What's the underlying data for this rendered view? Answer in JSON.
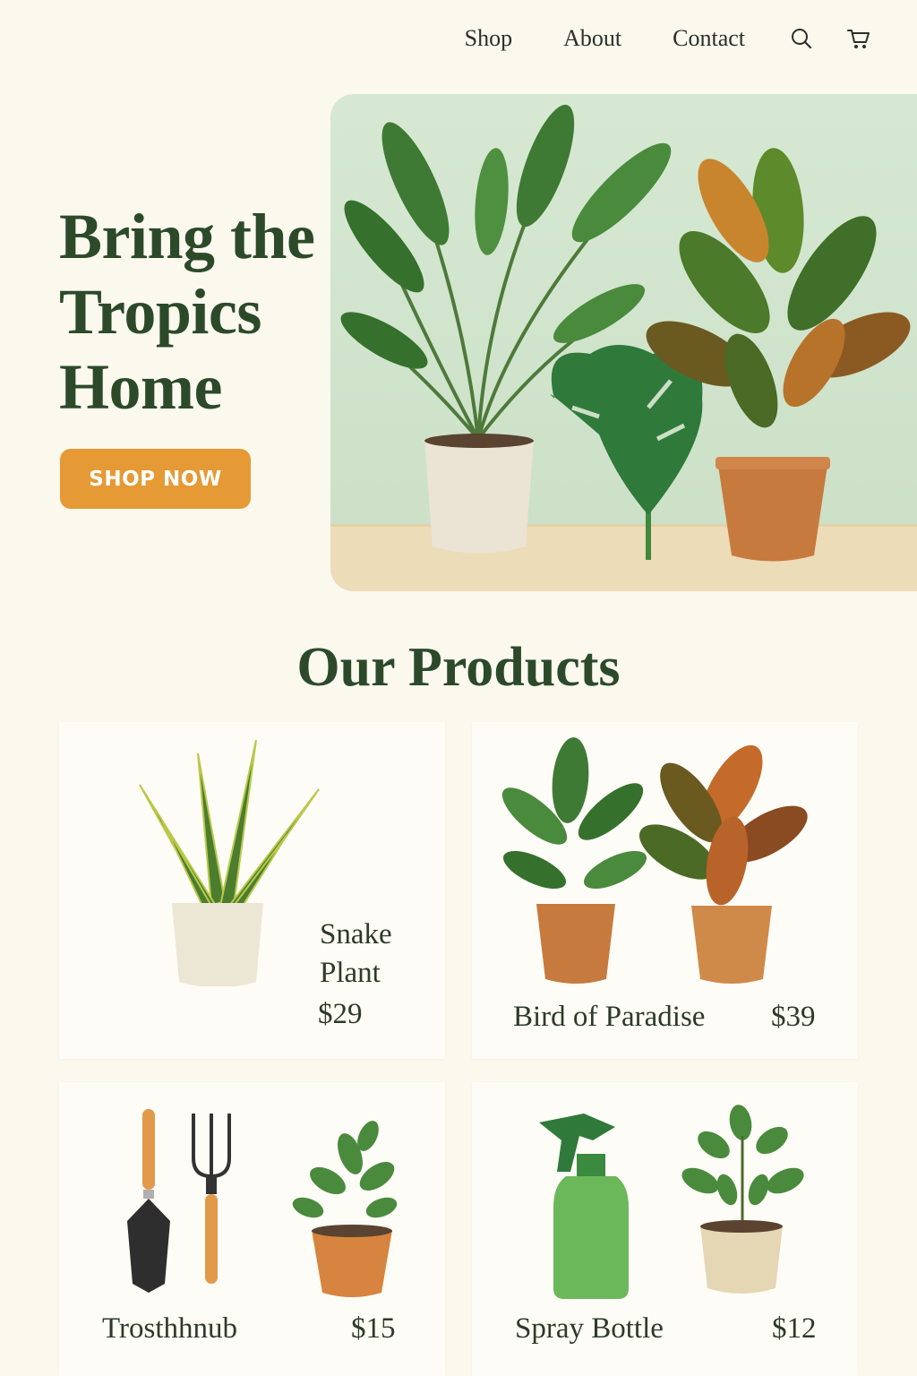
{
  "nav": {
    "links": [
      "Shop",
      "About",
      "Contact"
    ],
    "icons": [
      "search-icon",
      "cart-icon"
    ]
  },
  "hero": {
    "title": "Bring the Tropics Home",
    "cta_label": "SHOP NOW",
    "accent_color": "#e59a35"
  },
  "products": {
    "section_title": "Our Products",
    "items": [
      {
        "name": "Snake Plant",
        "price": "$29"
      },
      {
        "name": "Bird of Paradise",
        "price": "$39"
      },
      {
        "name": "Trosthhnub",
        "price": "$15"
      },
      {
        "name": "Spray Bottle",
        "price": "$12"
      }
    ]
  },
  "colors": {
    "background": "#fbf8ee",
    "heading": "#2c4a2a",
    "card": "#fefcf6"
  }
}
